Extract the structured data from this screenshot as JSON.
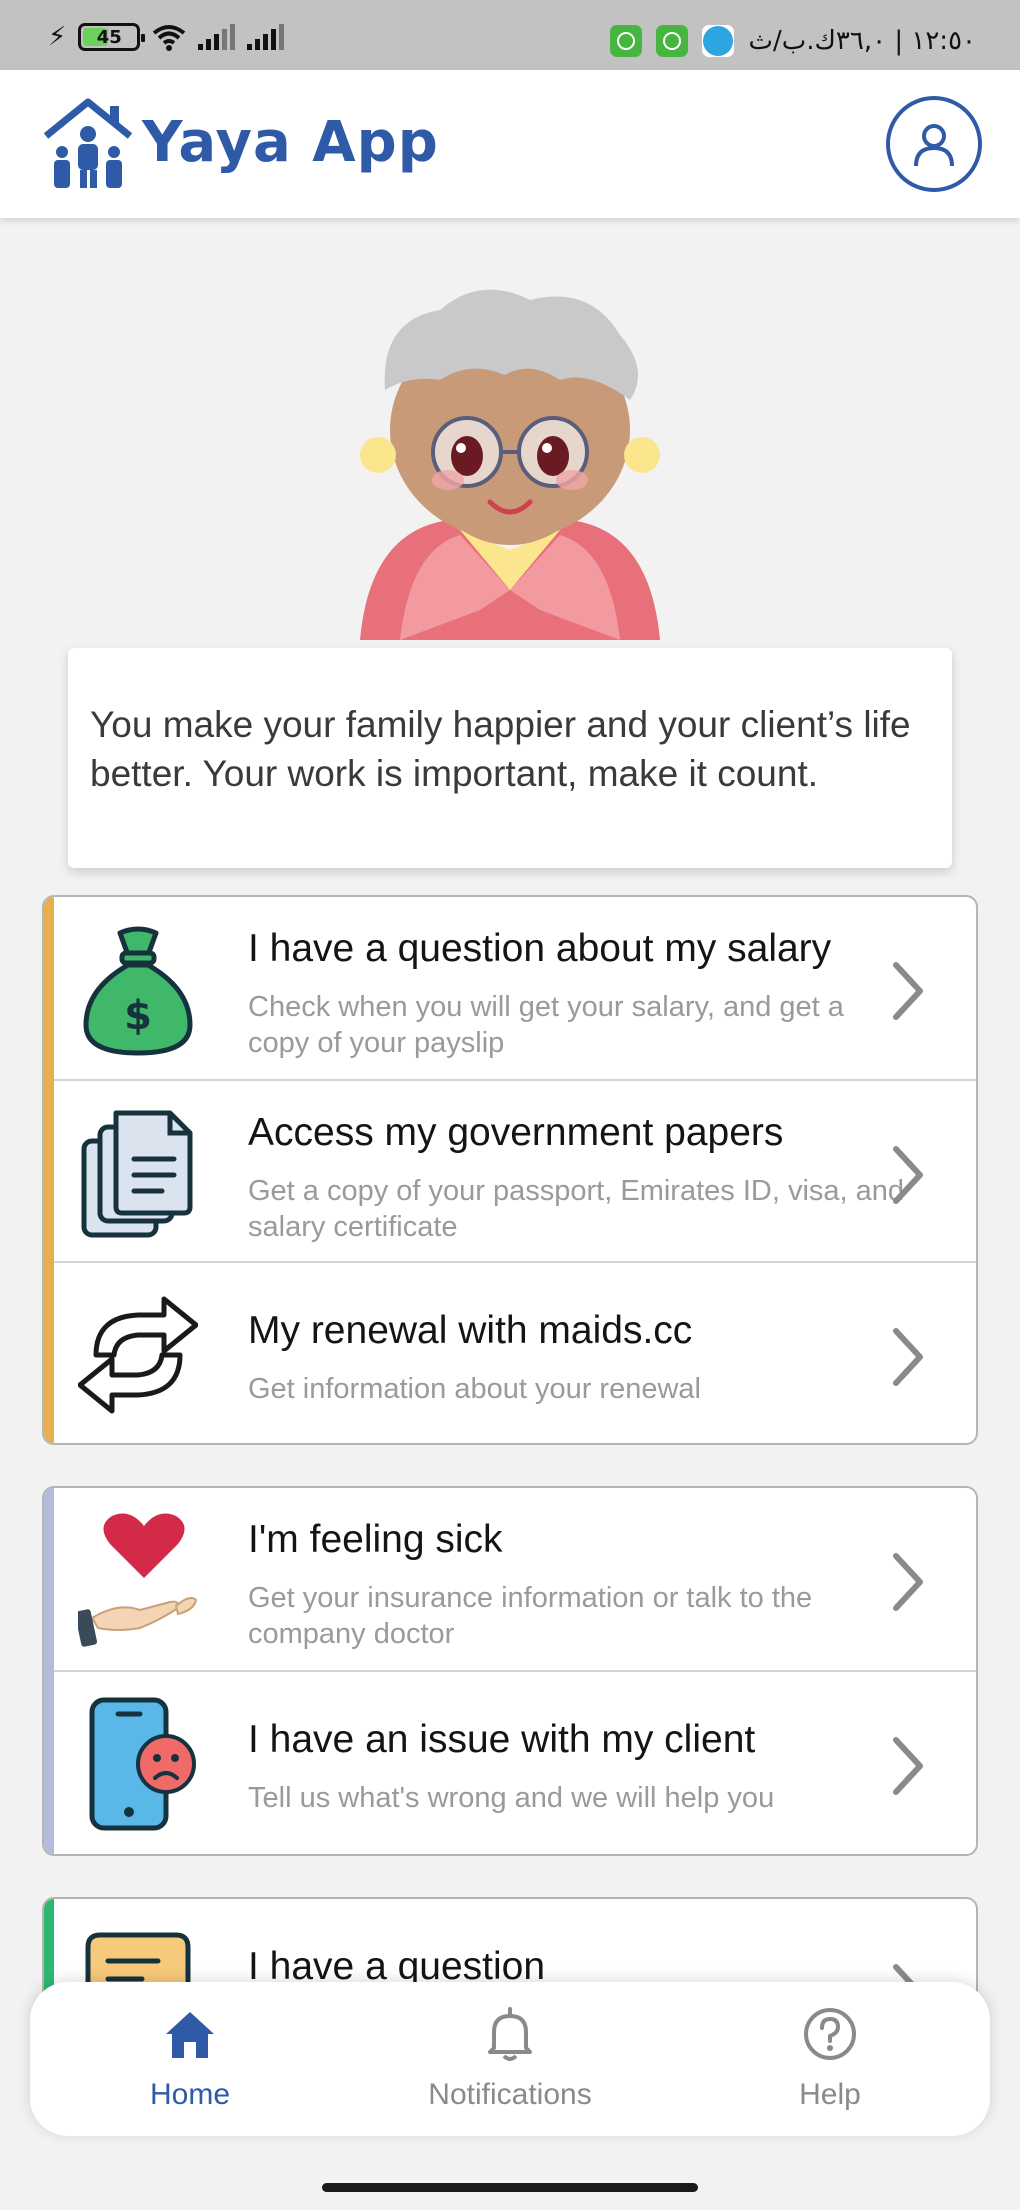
{
  "status_bar": {
    "battery": "45",
    "time": "١٢:٥٠ | ٣٦,٠ك.ب/ث"
  },
  "header": {
    "app_title": "Yaya App",
    "icons": {
      "logo": "family-house-logo",
      "profile": "user-profile-icon"
    }
  },
  "quote": "You make your family happier and your client’s life better. Your work is important, make it count.",
  "groups": [
    {
      "accent_color": "#e6b04f",
      "items": [
        {
          "icon": "money-bag-icon",
          "title": "I have a question about my salary",
          "description": "Check when you will get your salary, and get a copy of your payslip"
        },
        {
          "icon": "documents-icon",
          "title": "Access my government papers",
          "description": "Get a copy of your passport, Emirates ID, visa, and salary certificate"
        },
        {
          "icon": "renewal-arrows-icon",
          "title": "My renewal with maids.cc",
          "description": "Get information about your renewal"
        }
      ]
    },
    {
      "accent_color": "#b4bcdc",
      "items": [
        {
          "icon": "heart-hand-icon",
          "title": "I'm feeling sick",
          "description": "Get your insurance information or talk to the company doctor"
        },
        {
          "icon": "sad-phone-icon",
          "title": "I have an issue with my client",
          "description": "Tell us what's wrong and we will help you"
        }
      ]
    },
    {
      "accent_color": "#2db870",
      "items": [
        {
          "icon": "chat-bubble-icon",
          "title": "I have a question",
          "description": ""
        }
      ]
    }
  ],
  "bottom_nav": {
    "home": "Home",
    "notifications": "Notifications",
    "help": "Help",
    "active_color": "#2e5aa7"
  }
}
